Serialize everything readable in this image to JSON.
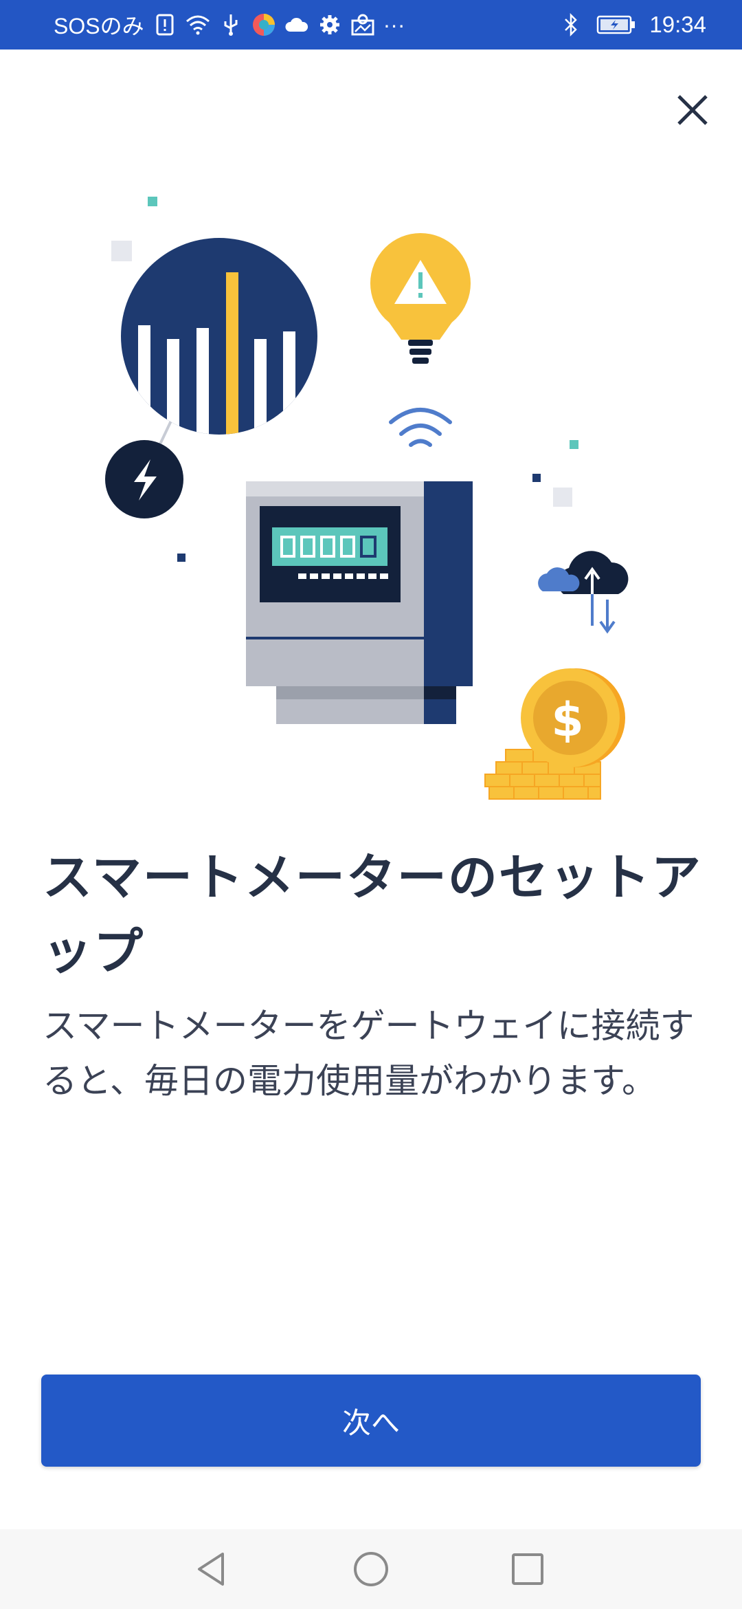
{
  "status_bar": {
    "carrier": "SOSのみ",
    "more": "···",
    "time": "19:34",
    "icons": [
      "sim-alert-icon",
      "wifi-icon",
      "usb-icon",
      "app-icon",
      "cloud-icon",
      "gear-icon",
      "photo-icon",
      "bluetooth-icon",
      "battery-icon"
    ]
  },
  "dialog": {
    "close_icon": "close-icon",
    "title": "スマートメーターのセットアップ",
    "description": "スマートメーターをゲートウェイに接続すると、毎日の電力使用量がわかります。",
    "next_label": "次へ"
  },
  "illustration": {
    "dollar_symbol": "$",
    "alert_symbol": "!",
    "colors": {
      "navy": "#1e3a70",
      "dark": "#13213b",
      "yellow": "#f8c23c",
      "teal": "#5cc6bb",
      "gray": "#b9bcc6",
      "blue": "#4f7ccb"
    }
  },
  "nav_bar": {
    "back_icon": "back-triangle-icon",
    "home_icon": "home-circle-icon",
    "recents_icon": "recents-square-icon"
  },
  "colors": {
    "status_bar": "#2356c4",
    "primary_button": "#2359c7",
    "title_text": "#263146",
    "body_text": "#3b4255"
  }
}
